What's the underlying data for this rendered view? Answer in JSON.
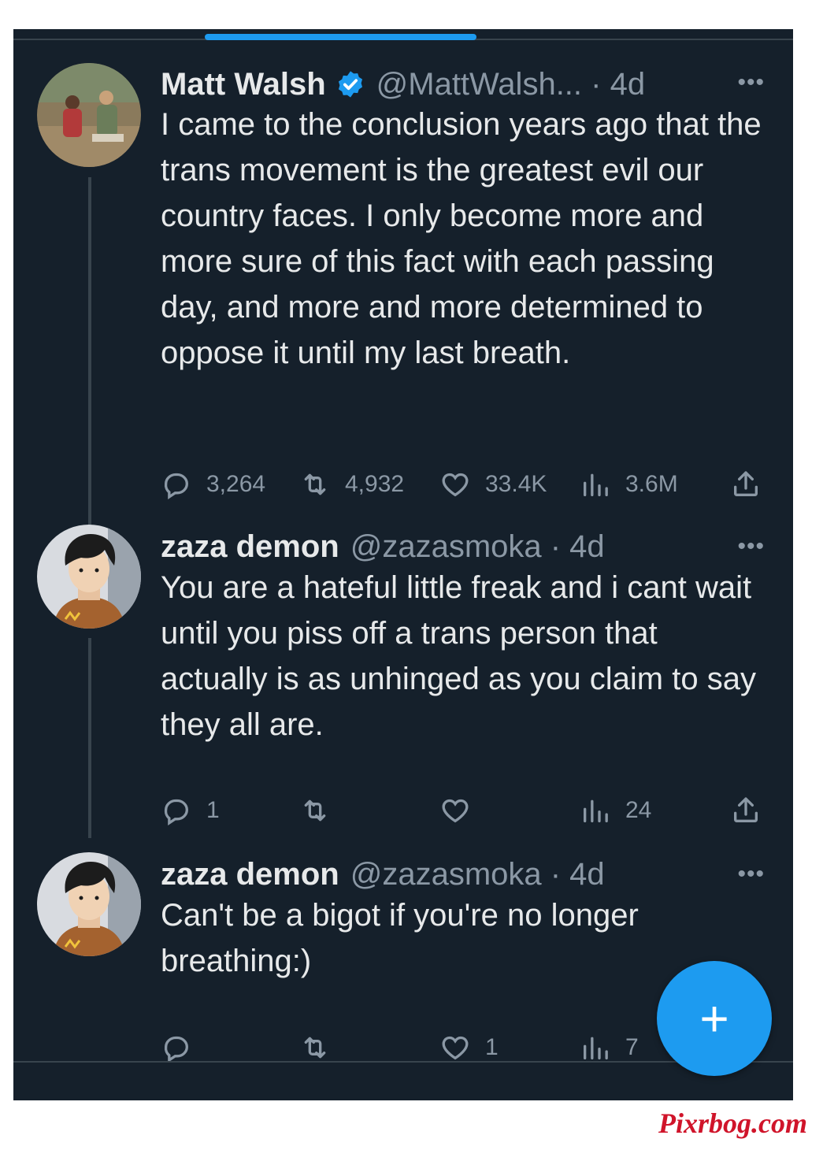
{
  "colors": {
    "background": "#15202b",
    "text": "#e7e9ea",
    "secondary": "#8b98a5",
    "accent": "#1d9bf0",
    "watermark": "#d0142a"
  },
  "tweets": [
    {
      "name": "Matt Walsh",
      "verified": true,
      "handle": "@MattWalsh... · 4d",
      "more": "•••",
      "text": "I came to the conclusion years ago that the trans movement is the greatest evil our country faces. I only become more and more sure of this fact with each passing day, and more and more determined to oppose it until my last breath.",
      "replies": "3,264",
      "retweets": "4,932",
      "likes": "33.4K",
      "views": "3.6M",
      "avatar_icon": "avatar-photo-icon"
    },
    {
      "name": "zaza demon",
      "handle": "@zazasmoka · 4d",
      "more": "•••",
      "text": "You are a hateful little freak and i cant wait until you piss off a trans person that actually is as unhinged as you claim to say they all are.",
      "replies": "1",
      "retweets": "",
      "likes": "",
      "views": "24",
      "avatar_icon": "anime-avatar-icon"
    },
    {
      "name": "zaza demon",
      "handle": "@zazasmoka · 4d",
      "more": "•••",
      "text": "Can't be a bigot if you're no longer breathing:)",
      "replies": "",
      "retweets": "",
      "likes": "1",
      "views": "7",
      "avatar_icon": "anime-avatar-icon"
    }
  ],
  "fab": {
    "label": "+",
    "icon": "compose-plus-icon"
  },
  "watermark": "Pixrbog.com"
}
